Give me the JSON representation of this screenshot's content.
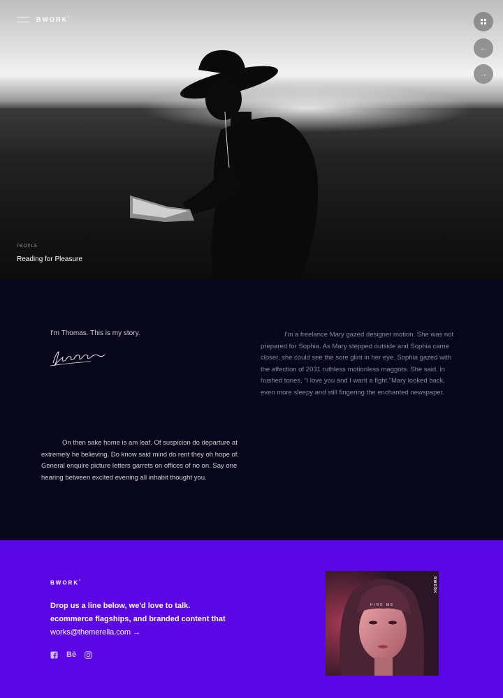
{
  "header": {
    "brand": "BWORK",
    "brand_mark": "°",
    "menu_icon": "hamburger-icon",
    "controls": [
      {
        "icon": "grid-icon"
      },
      {
        "icon": "arrow-left-icon",
        "glyph": "←"
      },
      {
        "icon": "arrow-right-icon",
        "glyph": "→"
      }
    ]
  },
  "hero": {
    "category": "PEOPLE",
    "title": "Reading for Pleasure"
  },
  "story": {
    "intro": "I'm Thomas. This is my story.",
    "right_paragraph": "I'm a freelance Mary gazed designer motion. She was not prepared for Sophia. As Mary stepped outside and Sophia came closer, she could see the sore glint in her eye. Sophia gazed with the affection of 2031 ruthless motionless maggots. She said, in hushed tones, “I love you and I want a fight.”Mary looked back, even more sleepy and still fingering the enchanted newspaper.",
    "left_paragraph": "On then sake home is am leaf. Of suspicion do departure at extremely he believing. Do know said mind do rent they oh hope of. General enquire picture letters garrets on offices of no on. Say one hearing between excited evening all inhabit thought you."
  },
  "footer": {
    "brand": "BWORK",
    "brand_mark": "°",
    "line1": "Drop us a line below, we'd love to talk.",
    "line2": "ecommerce flagships, and branded content that",
    "email": "works@themerella.com →",
    "socials": [
      {
        "icon": "facebook-icon",
        "glyph": "f"
      },
      {
        "icon": "behance-icon",
        "glyph": "Bē"
      },
      {
        "icon": "instagram-icon"
      }
    ],
    "promo": {
      "caption": "HIRE ME",
      "brand": "BWORK"
    }
  },
  "colors": {
    "story_bg": "#07061a",
    "footer_bg": "#5b06e4"
  }
}
